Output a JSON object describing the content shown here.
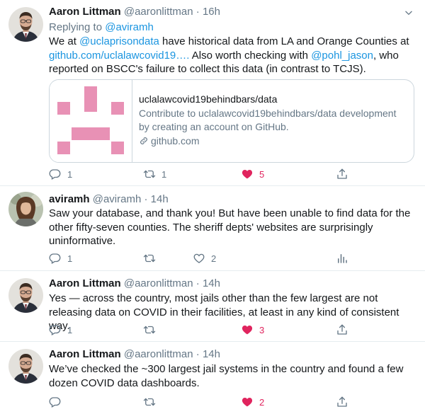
{
  "tweets": [
    {
      "name": "Aaron Littman",
      "handle": "@aaronlittman",
      "time": "16h",
      "replying_prefix": "Replying to ",
      "replying_to": "@aviramh",
      "text_parts": {
        "p1": "We at ",
        "link1": "@uclaprisondata",
        "p2": " have historical data from LA and Orange Counties at ",
        "link2": "github.com/uclalawcovid19….",
        "p3": "  Also worth checking with ",
        "link3": "@pohl_jason",
        "p4": ", who reported on BSCC's failure to collect this data (in contrast to TCJS)."
      },
      "card": {
        "title": "uclalawcovid19behindbars/data",
        "description": "Contribute to uclalawcovid19behindbars/data development by creating an account on GitHub.",
        "domain": "github.com"
      },
      "actions": {
        "reply": "1",
        "retweet": "1",
        "like": "5",
        "liked": true
      },
      "avatar": "man-glasses-suit"
    },
    {
      "name": "aviramh",
      "handle": "@aviramh",
      "time": "14h",
      "text": "Saw your database, and thank you! But have been unable to find data for the other fifty-seven counties. The sheriff depts' websites are surprisingly uninformative.",
      "actions": {
        "reply": "1",
        "retweet": "",
        "like": "2",
        "liked": false
      },
      "avatar": "woman-curly-hair"
    },
    {
      "name": "Aaron Littman",
      "handle": "@aaronlittman",
      "time": "14h",
      "text": "Yes — across the country, most jails other than the few largest are not releasing data on COVID in their facilities, at least in any kind of consistent way.",
      "actions": {
        "reply": "1",
        "retweet": "",
        "like": "3",
        "liked": true
      },
      "avatar": "man-glasses-suit"
    },
    {
      "name": "Aaron Littman",
      "handle": "@aaronlittman",
      "time": "14h",
      "text": "We’ve checked the ~300 largest jail systems in the country and found a few dozen COVID data dashboards.",
      "actions": {
        "reply": "",
        "retweet": "",
        "like": "2",
        "liked": true
      },
      "avatar": "man-glasses-suit"
    }
  ],
  "separator": " · ",
  "colors": {
    "link": "#1b95e0",
    "like": "#e0245e",
    "muted": "#657786",
    "border": "#e6ecf0"
  },
  "icons": [
    "reply-icon",
    "retweet-icon",
    "heart-icon",
    "share-icon",
    "analytics-icon",
    "chevron-down-icon",
    "link-icon",
    "github-identicon"
  ]
}
